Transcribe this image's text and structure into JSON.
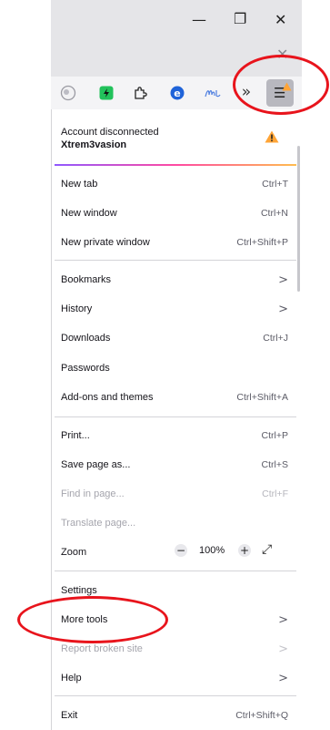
{
  "window": {
    "minimize_glyph": "—",
    "restore_glyph": "❐",
    "close_glyph": "✕",
    "tab_close_glyph": "✕"
  },
  "toolbar": {
    "overflow_glyph": "»",
    "menu_glyph": "☰",
    "extension_icons": [
      "privacy-extension-icon",
      "green-extension-icon",
      "extensions-puzzle-icon",
      "blue-e-extension-icon",
      "handwriting-extension-icon"
    ],
    "colors": {
      "menu_button_bg": "#b8b8bf",
      "warning": "#ffa436"
    }
  },
  "account": {
    "status": "Account disconnected",
    "name": "Xtrem3vasion",
    "warning_icon": "warning-icon"
  },
  "menu": {
    "new_tab": {
      "label": "New tab",
      "shortcut": "Ctrl+T"
    },
    "new_window": {
      "label": "New window",
      "shortcut": "Ctrl+N"
    },
    "new_private_window": {
      "label": "New private window",
      "shortcut": "Ctrl+Shift+P"
    },
    "bookmarks": {
      "label": "Bookmarks",
      "chevron": ">"
    },
    "history": {
      "label": "History",
      "chevron": ">"
    },
    "downloads": {
      "label": "Downloads",
      "shortcut": "Ctrl+J"
    },
    "passwords": {
      "label": "Passwords"
    },
    "addons": {
      "label": "Add-ons and themes",
      "shortcut": "Ctrl+Shift+A"
    },
    "print": {
      "label": "Print...",
      "shortcut": "Ctrl+P"
    },
    "save_page": {
      "label": "Save page as...",
      "shortcut": "Ctrl+S"
    },
    "find": {
      "label": "Find in page...",
      "shortcut": "Ctrl+F",
      "disabled": true
    },
    "translate": {
      "label": "Translate page...",
      "disabled": true
    },
    "zoom": {
      "label": "Zoom",
      "minus": "−",
      "value": "100%",
      "plus": "+",
      "fullscreen_glyph": "⤢"
    },
    "settings": {
      "label": "Settings"
    },
    "more_tools": {
      "label": "More tools",
      "chevron": ">"
    },
    "report": {
      "label": "Report broken site",
      "chevron": ">",
      "disabled": true
    },
    "help": {
      "label": "Help",
      "chevron": ">"
    },
    "exit": {
      "label": "Exit",
      "shortcut": "Ctrl+Shift+Q"
    }
  },
  "annotations": {
    "color": "#e8141c"
  }
}
